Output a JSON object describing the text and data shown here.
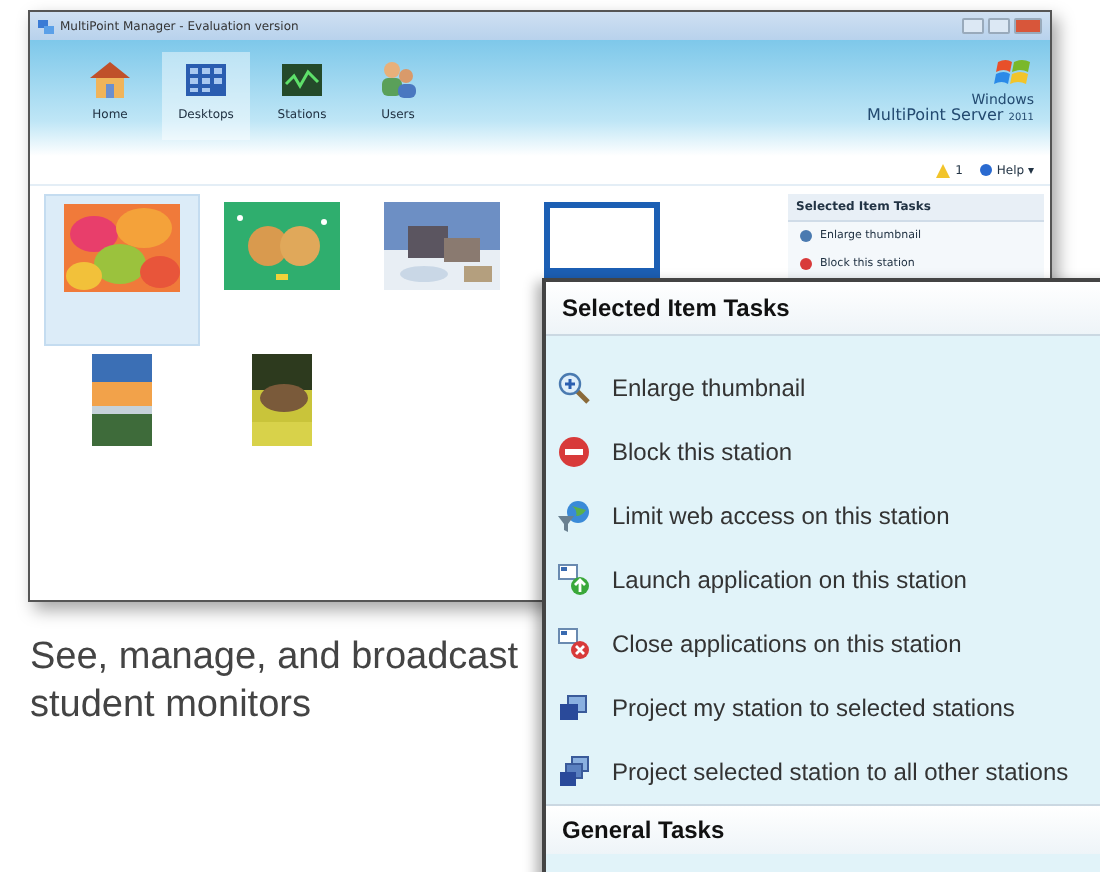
{
  "window": {
    "title": "MultiPoint Manager - Evaluation version"
  },
  "nav": [
    {
      "label": "Home",
      "kind": "home",
      "selected": false
    },
    {
      "label": "Desktops",
      "kind": "desktops",
      "selected": true
    },
    {
      "label": "Stations",
      "kind": "stations",
      "selected": false
    },
    {
      "label": "Users",
      "kind": "users",
      "selected": false
    }
  ],
  "brand": {
    "line1": "Windows",
    "line2": "MultiPoint Server",
    "edition": "2011"
  },
  "alerts": {
    "count": "1"
  },
  "help": {
    "label": "Help",
    "caret": "▾"
  },
  "thumbnails": [
    {
      "kind": "landscape",
      "selected": true
    },
    {
      "kind": "landscape",
      "selected": false
    },
    {
      "kind": "landscape",
      "selected": false
    },
    {
      "kind": "screen",
      "selected": false
    },
    {
      "kind": "portrait",
      "selected": false
    },
    {
      "kind": "portrait",
      "selected": false
    }
  ],
  "task_pane": {
    "title": "Selected Item Tasks",
    "items": [
      {
        "label": "Enlarge thumbnail",
        "kind": "zoom"
      },
      {
        "label": "Block this station",
        "kind": "block"
      }
    ]
  },
  "callout": {
    "title": "Selected Item Tasks",
    "items": [
      {
        "label": "Enlarge thumbnail",
        "kind": "zoom"
      },
      {
        "label": "Block this station",
        "kind": "block"
      },
      {
        "label": "Limit web access on this station",
        "kind": "globe"
      },
      {
        "label": "Launch application on this station",
        "kind": "launch"
      },
      {
        "label": "Close applications on this station",
        "kind": "close"
      },
      {
        "label": "Project my station to selected stations",
        "kind": "project"
      },
      {
        "label": "Project selected station to all other stations",
        "kind": "projectall"
      }
    ],
    "footer": "General Tasks"
  },
  "caption": "See, manage, and broadcast student monitors"
}
